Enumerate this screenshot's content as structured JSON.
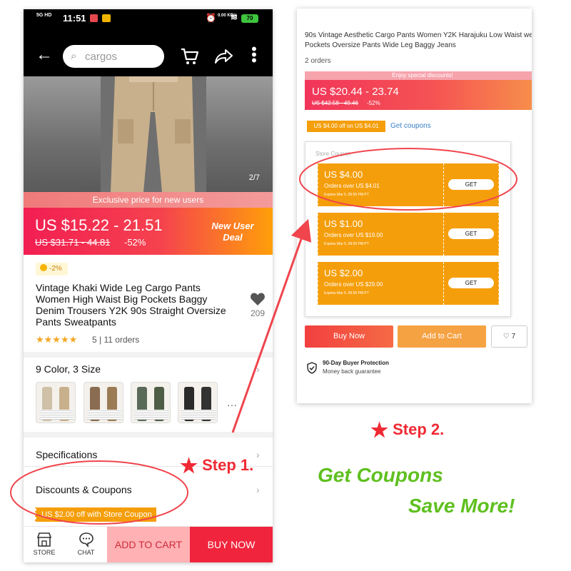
{
  "status_bar": {
    "signal": "5G HD",
    "time": "11:51",
    "net_speed": "0.00 KB/s",
    "battery": "70"
  },
  "top_bar": {
    "search_placeholder": "cargos"
  },
  "gallery": {
    "counter": "2/7"
  },
  "promo": {
    "exclusive_text": "Exclusive price for new users",
    "price_range": "US $15.22 - 21.51",
    "original_price": "US $31.71 - 44.81",
    "discount": "-52%",
    "deal_label": "New User Deal"
  },
  "product": {
    "coin_badge": "-2%",
    "title": "Vintage Khaki Wide Leg Cargo Pants Women High Waist Big Pockets Baggy Denim Trousers Y2K 90s Straight Oversize Pants Sweatpants",
    "wishlist_count": "209",
    "stars": "★★★★★",
    "rating": "5",
    "orders": "11 orders"
  },
  "variants": {
    "label": "9 Color, 3 Size",
    "more": "···"
  },
  "sections": {
    "specifications": "Specifications",
    "discounts": "Discounts & Coupons",
    "store_coupon_tag": "US $2.00 off with Store Coupon"
  },
  "bottom_bar": {
    "store": "STORE",
    "chat": "CHAT",
    "add_to_cart": "ADD TO CART",
    "buy_now": "BUY NOW"
  },
  "panel": {
    "title": "90s Vintage Aesthetic Cargo Pants Women Y2K Harajuku Low Waist wear Pockets Oversize Pants Wide Leg Baggy Jeans",
    "orders": "2 orders",
    "special_strip": "Enjoy special discounts!",
    "price_range": "US $20.44 - 23.74",
    "original_price": "US $42.58 - 49.46",
    "discount": "-52%",
    "coupon_tag": "US $4.00 off on US $4.01",
    "get_coupons_link": "Get coupons",
    "store_coupon_header": "Store Coupon",
    "coupons": [
      {
        "amount": "US $4.00",
        "condition": "Orders over US $4.01",
        "expires": "Expires Mar 5, 09:55 PM PT",
        "button": "GET"
      },
      {
        "amount": "US $1.00",
        "condition": "Orders over US $19.00",
        "expires": "Expires Mar 5, 09:55 PM PT",
        "button": "GET"
      },
      {
        "amount": "US $2.00",
        "condition": "Orders over US $29.00",
        "expires": "Expires Mar 5, 09:55 PM PT",
        "button": "GET"
      }
    ],
    "buy_now": "Buy Now",
    "add_to_cart": "Add to Cart",
    "wish_count": "7",
    "protection_title": "90-Day Buyer Protection",
    "protection_sub": "Money back guarantee"
  },
  "annotations": {
    "step1": "Step 1.",
    "step2": "Step 2.",
    "slogan1": "Get Coupons",
    "slogan2": "Save More!"
  },
  "colors": {
    "accent_red": "#f0253d",
    "coupon_orange": "#f59e0b",
    "slogan_green": "#5fc01f",
    "annotation_red": "#f02a34"
  }
}
